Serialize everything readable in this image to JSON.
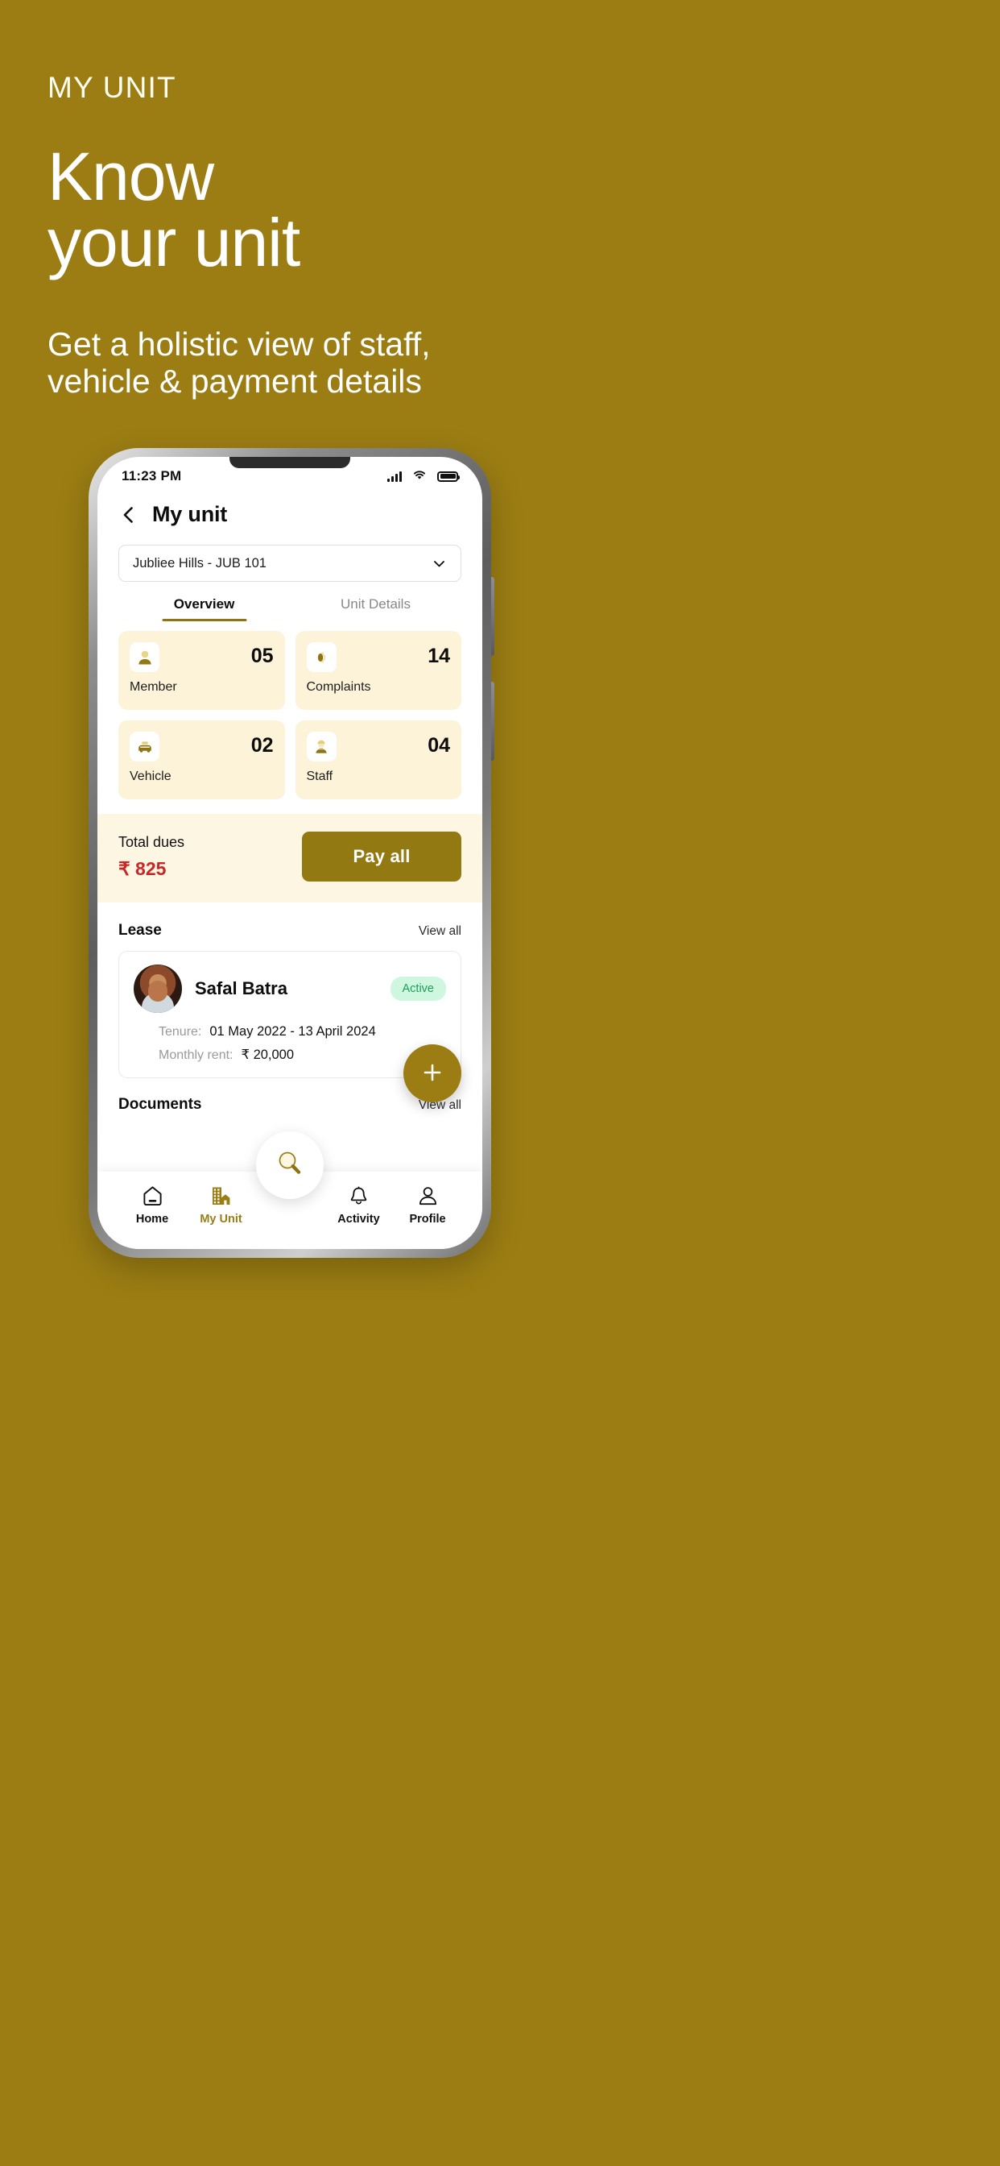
{
  "promo": {
    "eyebrow": "MY UNIT",
    "title_line1": "Know",
    "title_line2": "your unit",
    "sub_line1": "Get a holistic view of staff,",
    "sub_line2": "vehicle & payment details",
    "bg_color": "#9B7D13"
  },
  "phone": {
    "status": {
      "time": "11:23 PM",
      "signal_icon": "signal-bars-icon",
      "wifi_icon": "wifi-icon",
      "battery_icon": "battery-full-icon"
    },
    "header": {
      "back_icon": "chevron-left-icon",
      "title": "My unit"
    },
    "unit_select": {
      "value": "Jubliee Hills - JUB 101",
      "chevron_icon": "chevron-down-icon"
    },
    "tabs": [
      {
        "label": "Overview",
        "active": true
      },
      {
        "label": "Unit Details",
        "active": false
      }
    ],
    "stats": [
      {
        "label": "Member",
        "value": "05",
        "icon": "person-icon"
      },
      {
        "label": "Complaints",
        "value": "14",
        "icon": "megaphone-icon"
      },
      {
        "label": "Vehicle",
        "value": "02",
        "icon": "car-icon"
      },
      {
        "label": "Staff",
        "value": "04",
        "icon": "worker-icon"
      }
    ],
    "dues": {
      "title": "Total dues",
      "amount": "₹ 825",
      "pay_button": "Pay all",
      "amount_color": "#C62828",
      "button_color": "#937911"
    },
    "lease": {
      "section_title": "Lease",
      "view_all": "View all",
      "person_name": "Safal Batra",
      "status_badge": "Active",
      "badge_color": "#1E9E58",
      "tenure_label": "Tenure:",
      "tenure_value": "01 May 2022 - 13 April 2024",
      "rent_label": "Monthly rent:",
      "rent_value": "₹ 20,000",
      "avatar_icon": "user-avatar-photo"
    },
    "documents": {
      "section_title": "Documents",
      "view_all": "View all"
    },
    "fab": {
      "icon": "plus-icon"
    },
    "search_fab": {
      "icon": "search-icon"
    },
    "bottom_nav": [
      {
        "label": "Home",
        "icon": "home-icon",
        "active": false
      },
      {
        "label": "My Unit",
        "icon": "building-icon",
        "active": true
      },
      {
        "label": "Activity",
        "icon": "bell-icon",
        "active": false
      },
      {
        "label": "Profile",
        "icon": "person-icon",
        "active": false
      }
    ]
  }
}
